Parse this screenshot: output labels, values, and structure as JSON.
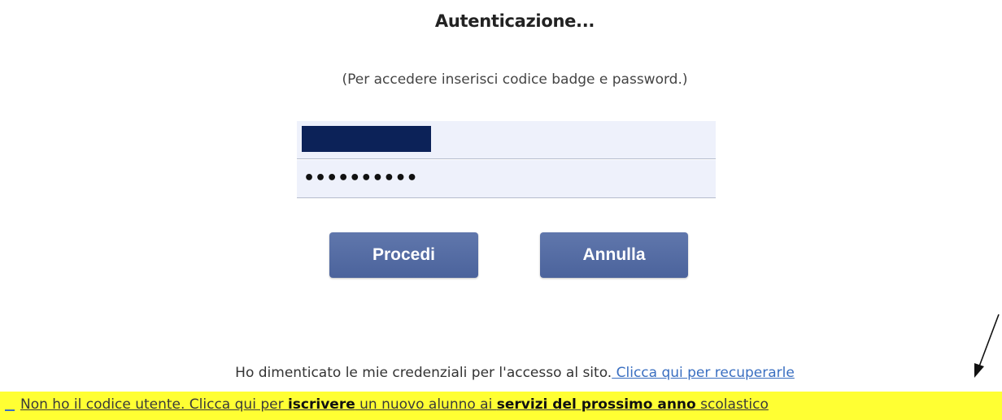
{
  "page": {
    "title": "Autenticazione...",
    "instructions": "(Per accedere inserisci codice badge e password.)"
  },
  "form": {
    "username_value": "",
    "username_redacted": true,
    "password_value": "••••••••••"
  },
  "buttons": {
    "proceed_label": "Procedi",
    "cancel_label": "Annulla"
  },
  "forgot": {
    "text": "Ho dimenticato le mie credenziali per l'accesso al sito.",
    "link_label": " Clicca qui per recuperarle"
  },
  "register": {
    "part1": "Non ho il codice utente. Clicca qui per ",
    "bold1": "iscrivere",
    "part2": " un nuovo alunno ai ",
    "bold2": "servizi del prossimo anno",
    "part3": " scolastico"
  },
  "colors": {
    "button": "#4f67a0",
    "highlight": "#ffff33",
    "link": "#3a6fc1",
    "redaction": "#0c2258",
    "field_bg": "#eef1fb"
  },
  "annotation": {
    "icon": "arrow-pointer-icon"
  }
}
